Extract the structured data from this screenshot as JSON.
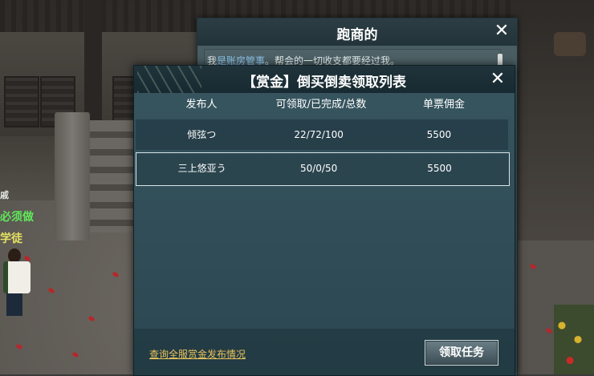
{
  "world": {
    "npc_labels": [
      "戚",
      "必须做",
      "学徒"
    ]
  },
  "back_dialog": {
    "title": "跑商的",
    "close_icon": "close-icon",
    "text_prefix": "我",
    "text_highlight": "是账房管事",
    "text_suffix": "。帮会的一切收支都要经过我。"
  },
  "panel": {
    "title": "【赏金】倒买倒卖领取列表",
    "close_icon": "close-icon",
    "columns": [
      "发布人",
      "可领取/已完成/总数",
      "单票佣金"
    ],
    "rows": [
      {
        "publisher": "倾弦つ",
        "counts": "22/72/100",
        "commission": "5500"
      },
      {
        "publisher": "三上悠亚う",
        "counts": "50/0/50",
        "commission": "5500"
      }
    ],
    "selected_row": 1,
    "query_link": "查询全服赏金发布情况",
    "claim_button": "领取任务"
  },
  "colors": {
    "link": "#e8c35a",
    "highlight": "#8fc8f0",
    "npc_green": "#5fe85a",
    "npc_yellow": "#e3e062"
  }
}
